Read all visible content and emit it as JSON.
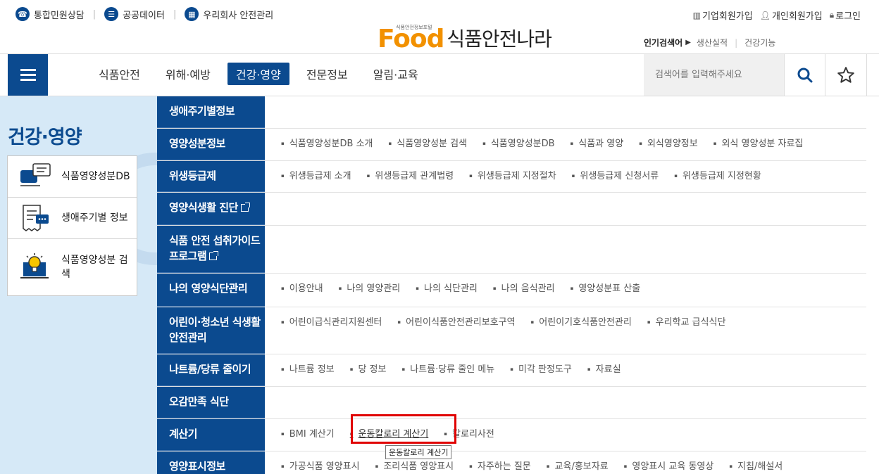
{
  "topbar": {
    "left": [
      {
        "label": "통합민원상담",
        "icon": "headset-icon"
      },
      {
        "label": "공공데이터",
        "icon": "list-icon"
      },
      {
        "label": "우리회사 안전관리",
        "icon": "building-icon"
      }
    ],
    "right": [
      {
        "label": "기업회원가입",
        "icon": "building-icon"
      },
      {
        "label": "개인회원가입",
        "icon": "person-icon"
      },
      {
        "label": "로그인",
        "icon": "lock-icon"
      }
    ]
  },
  "logo": {
    "food": "Food",
    "name": "식품안전나라",
    "sub": "식품안전정보포털"
  },
  "popular": {
    "label": "인기검색어",
    "keywords": [
      "생산실적",
      "건강기능"
    ]
  },
  "nav": {
    "items": [
      "식품안전",
      "위해·예방",
      "건강·영양",
      "전문정보",
      "알림·교육"
    ],
    "active_index": 2
  },
  "search": {
    "placeholder": "검색어를 입력해주세요"
  },
  "left": {
    "title": "건강·영양",
    "quick": [
      {
        "label": "식품영양성분DB"
      },
      {
        "label": "생애주기별 정보"
      },
      {
        "label": "식품영양성분 검색"
      }
    ]
  },
  "mega": [
    {
      "cat": "생애주기별정보",
      "subs": []
    },
    {
      "cat": "영양성분정보",
      "subs": [
        "식품영양성분DB 소개",
        "식품영양성분 검색",
        "식품영양성분DB",
        "식품과 영양",
        "외식영양정보",
        "외식 영양성분 자료집"
      ]
    },
    {
      "cat": "위생등급제",
      "subs": [
        "위생등급제 소개",
        "위생등급제 관계법령",
        "위생등급제 지정절차",
        "위생등급제 신청서류",
        "위생등급제 지정현황"
      ]
    },
    {
      "cat": "영양식생활 진단",
      "subs": []
    },
    {
      "cat": "식품 안전 섭취가이드 프로그램",
      "subs": []
    },
    {
      "cat": "나의 영양식단관리",
      "subs": [
        "이용안내",
        "나의 영양관리",
        "나의 식단관리",
        "나의 음식관리",
        "영양성분표 산출"
      ]
    },
    {
      "cat": "어린이·청소년 식생활 안전관리",
      "subs": [
        "어린이급식관리지원센터",
        "어린이식품안전관리보호구역",
        "어린이기호식품안전관리",
        "우리학교 급식식단"
      ]
    },
    {
      "cat": "나트륨/당류 줄이기",
      "subs": [
        "나트륨 정보",
        "당 정보",
        "나트륨·당류 줄인 메뉴",
        "미각 판정도구",
        "자료실"
      ]
    },
    {
      "cat": "오감만족 식단",
      "subs": []
    },
    {
      "cat": "계산기",
      "subs": [
        "BMI 계산기",
        "운동칼로리 계산기",
        "칼로리사전"
      ]
    },
    {
      "cat": "영양표시정보",
      "subs": [
        "가공식품 영양표시",
        "조리식품 영양표시",
        "자주하는 질문",
        "교육/홍보자료",
        "영양표시 교육 동영상",
        "지침/해설서"
      ]
    }
  ],
  "tooltip": "운동칼로리 계산기"
}
